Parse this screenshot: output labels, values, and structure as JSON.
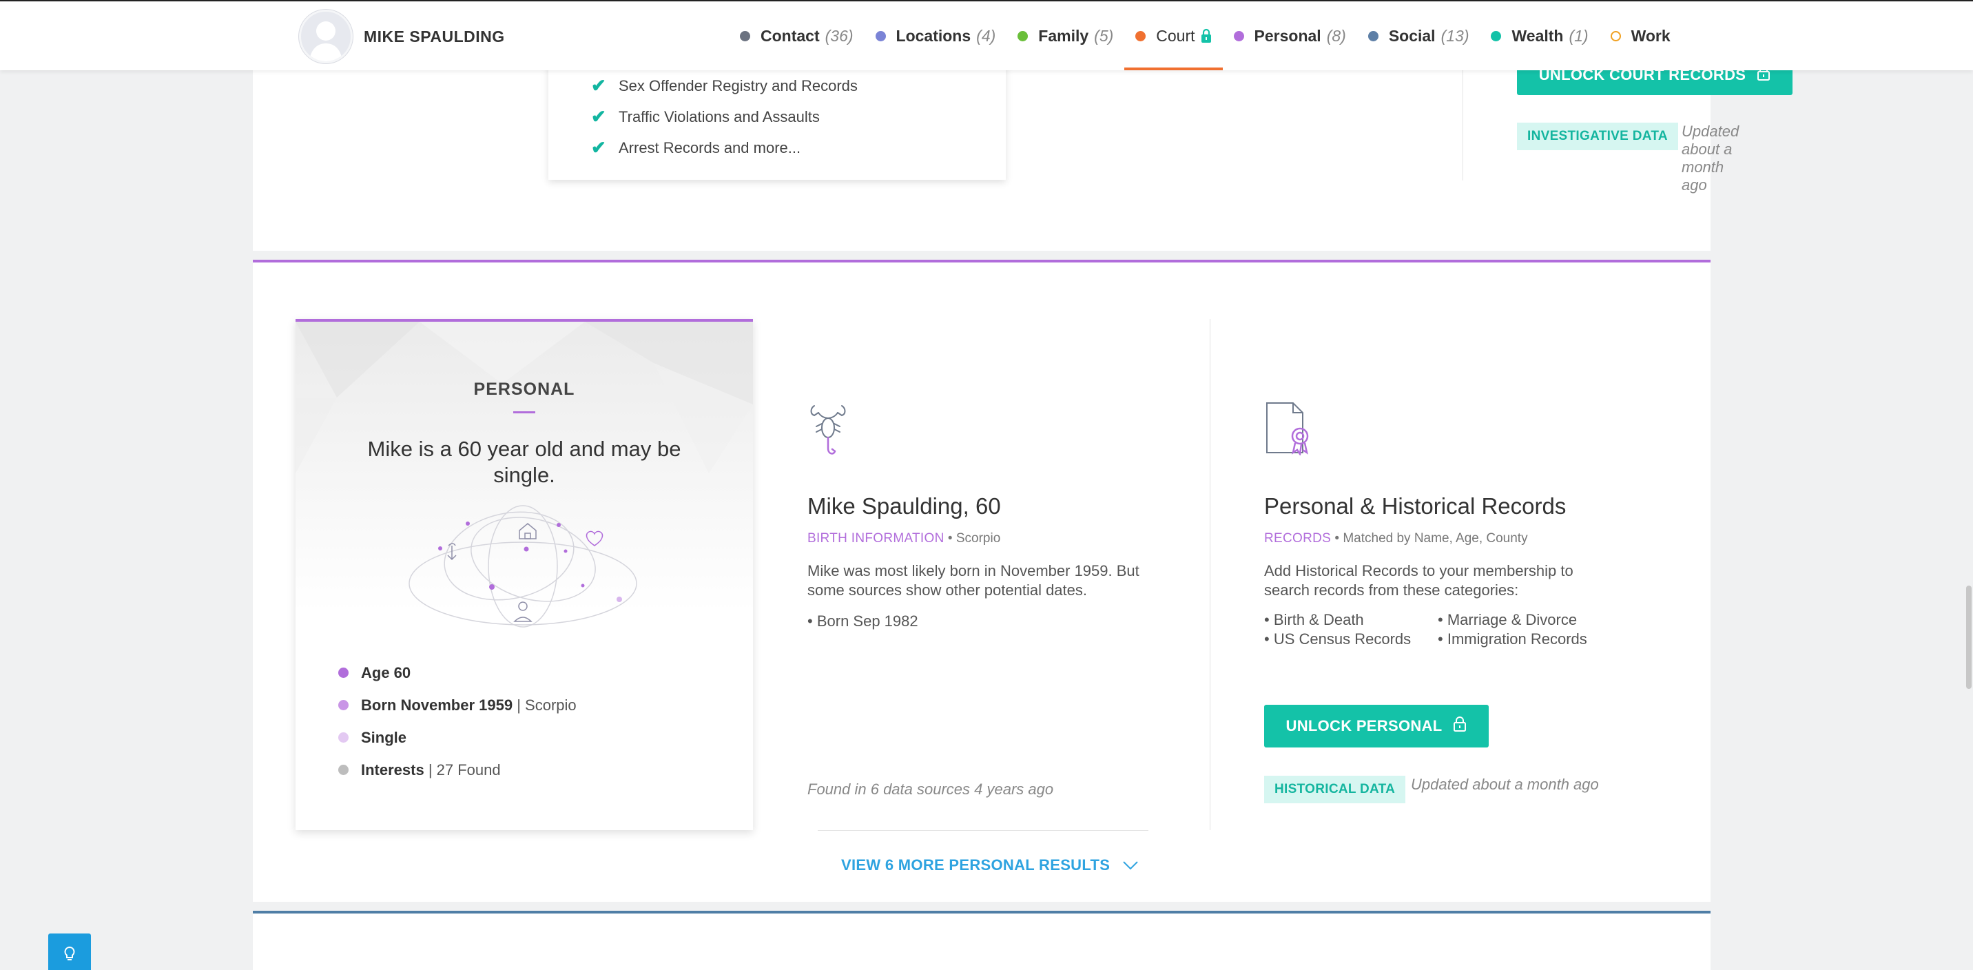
{
  "header": {
    "name": "MIKE SPAULDING",
    "nav": [
      {
        "label": "Contact",
        "count": "(36)",
        "color": "#6b7280",
        "active": false,
        "locked": false
      },
      {
        "label": "Locations",
        "count": "(4)",
        "color": "#7a83d6",
        "active": false,
        "locked": false
      },
      {
        "label": "Family",
        "count": "(5)",
        "color": "#6abf3a",
        "active": false,
        "locked": false
      },
      {
        "label": "Court",
        "count": "",
        "color": "#f07030",
        "active": true,
        "locked": true
      },
      {
        "label": "Personal",
        "count": "(8)",
        "color": "#b16ddb",
        "active": false,
        "locked": false
      },
      {
        "label": "Social",
        "count": "(13)",
        "color": "#5d7fa6",
        "active": false,
        "locked": false
      },
      {
        "label": "Wealth",
        "count": "(1)",
        "color": "#14c2a8",
        "active": false,
        "locked": false
      },
      {
        "label": "Work",
        "count": "",
        "color": "#f0a020",
        "active": false,
        "locked": false,
        "hollow": true
      }
    ]
  },
  "court": {
    "checklist": [
      "Sex Offender Registry and Records",
      "Traffic Violations and Assaults",
      "Arrest Records and more..."
    ],
    "unlock_label": "UNLOCK COURT RECORDS",
    "badge": "INVESTIGATIVE DATA",
    "updated": "Updated about a month ago"
  },
  "personal": {
    "card": {
      "title": "PERSONAL",
      "summary": "Mike is a 60 year old and may be single.",
      "facts": [
        {
          "bold": "Age 60",
          "rest": "",
          "color": "#b16ddb"
        },
        {
          "bold": "Born November 1959",
          "rest": " | Scorpio",
          "color": "#c995e6"
        },
        {
          "bold": "Single",
          "rest": "",
          "color": "#e3c9f2"
        },
        {
          "bold": "Interests",
          "rest": " | 27 Found",
          "color": "#bdbdbd"
        }
      ]
    },
    "birth": {
      "heading": "Mike Spaulding, 60",
      "tag": "BIRTH INFORMATION",
      "sub": "Scorpio",
      "description": "Mike was most likely born in November 1959. But some sources show other potential dates.",
      "alt_date": "Born Sep 1982",
      "found": "Found in 6 data sources 4 years ago"
    },
    "records": {
      "heading": "Personal & Historical Records",
      "tag": "RECORDS",
      "sub": "Matched by Name, Age, County",
      "description": "Add Historical Records to your membership to search records from these categories:",
      "categories": [
        "Birth & Death",
        "Marriage & Divorce",
        "US Census Records",
        "Immigration Records"
      ],
      "unlock_label": "UNLOCK PERSONAL",
      "badge": "HISTORICAL DATA",
      "updated": "Updated about a month ago"
    },
    "view_more": "VIEW 6 MORE PERSONAL RESULTS"
  }
}
